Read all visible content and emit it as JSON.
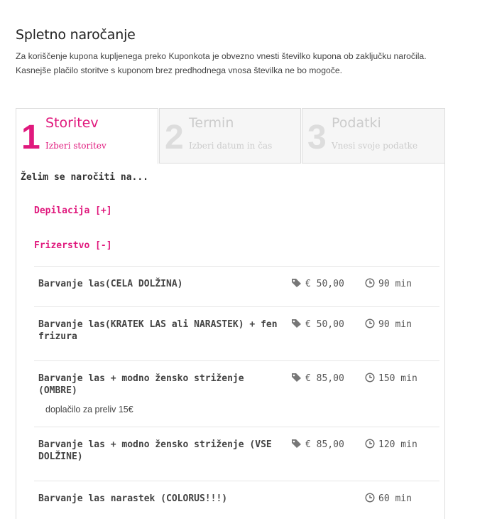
{
  "page": {
    "title": "Spletno naročanje",
    "intro": "Za koriščenje kupona kupljenega preko Kuponkota je obvezno vnesti številko kupona ob zaključku naročila. Kasnejše plačilo storitve s kuponom brez predhodnega vnosa številka ne bo mogoče."
  },
  "tabs": [
    {
      "number": "1",
      "title": "Storitev",
      "subtitle": "Izberi storitev"
    },
    {
      "number": "2",
      "title": "Termin",
      "subtitle": "Izberi datum in čas"
    },
    {
      "number": "3",
      "title": "Podatki",
      "subtitle": "Vnesi svoje podatke"
    }
  ],
  "content": {
    "heading": "Želim se naročiti na...",
    "categories": [
      "Depilacija [+]",
      "Frizerstvo [-]"
    ]
  },
  "services": [
    {
      "name": "Barvanje las(CELA DOLŽINA)",
      "price": "€ 50,00",
      "duration": "90 min",
      "note": ""
    },
    {
      "name": "Barvanje las(KRATEK LAS ali NARASTEK) + fen frizura",
      "price": "€ 50,00",
      "duration": "90 min",
      "note": ""
    },
    {
      "name": "Barvanje las + modno žensko striženje (OMBRE)",
      "price": "€ 85,00",
      "duration": "150 min",
      "note": "doplačilo za preliv 15€"
    },
    {
      "name": "Barvanje las + modno žensko striženje (VSE DOLŽINE)",
      "price": "€ 85,00",
      "duration": "120 min",
      "note": ""
    },
    {
      "name": "Barvanje las narastek (COLORUS!!!)",
      "price": "",
      "duration": "60 min",
      "note": ""
    }
  ],
  "colors": {
    "accent": "#e0197d",
    "muted": "#cccccc",
    "border": "#dddddd"
  },
  "icons": {
    "price": "price-tag-icon",
    "duration": "clock-icon"
  }
}
